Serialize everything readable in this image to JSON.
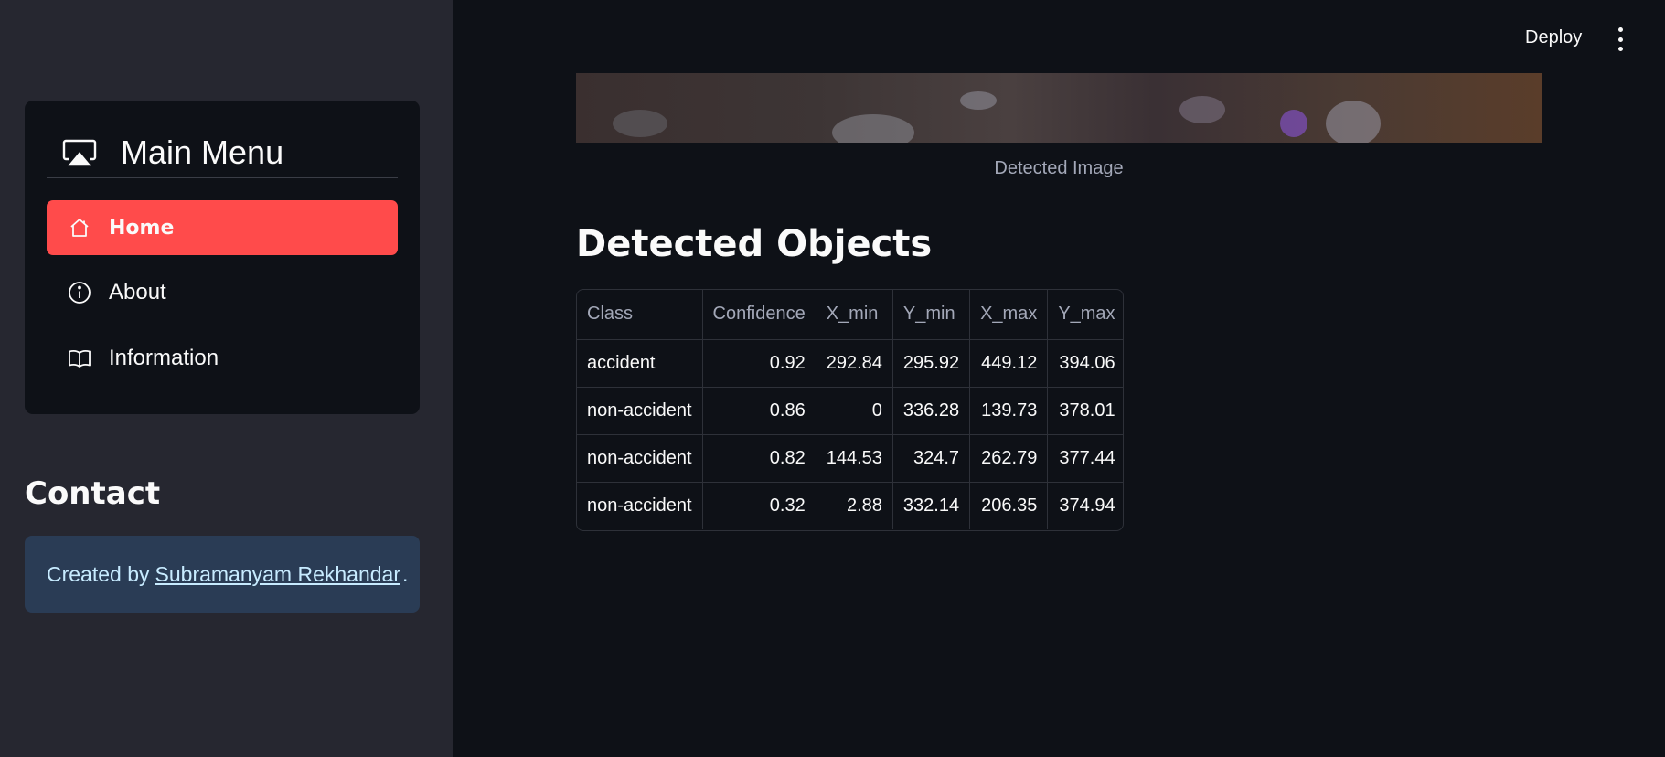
{
  "sidebar": {
    "menu_title": "Main Menu",
    "menu_icon": "airplay-icon",
    "items": [
      {
        "label": "Home",
        "icon": "house-icon",
        "active": true
      },
      {
        "label": "About",
        "icon": "info-circle-icon",
        "active": false
      },
      {
        "label": "Information",
        "icon": "book-icon",
        "active": false
      }
    ],
    "contact_title": "Contact",
    "contact": {
      "prefix": "Created by",
      "link_text": "Subramanyam Rekhandar",
      "suffix": "."
    }
  },
  "header": {
    "deploy_label": "Deploy",
    "menu_icon": "kebab-menu-icon"
  },
  "main": {
    "image_caption": "Detected Image",
    "section_title": "Detected Objects",
    "table": {
      "columns": [
        "Class",
        "Confidence",
        "X_min",
        "Y_min",
        "X_max",
        "Y_max"
      ],
      "rows": [
        [
          "accident",
          "0.92",
          "292.84",
          "295.92",
          "449.12",
          "394.06"
        ],
        [
          "non-accident",
          "0.86",
          "0",
          "336.28",
          "139.73",
          "378.01"
        ],
        [
          "non-accident",
          "0.82",
          "144.53",
          "324.7",
          "262.79",
          "377.44"
        ],
        [
          "non-accident",
          "0.32",
          "2.88",
          "332.14",
          "206.35",
          "374.94"
        ]
      ]
    }
  },
  "colors": {
    "accent": "#ff4b4b",
    "sidebar_bg": "#262730",
    "main_bg": "#0e1117",
    "info_box_bg": "#2a3c55"
  }
}
